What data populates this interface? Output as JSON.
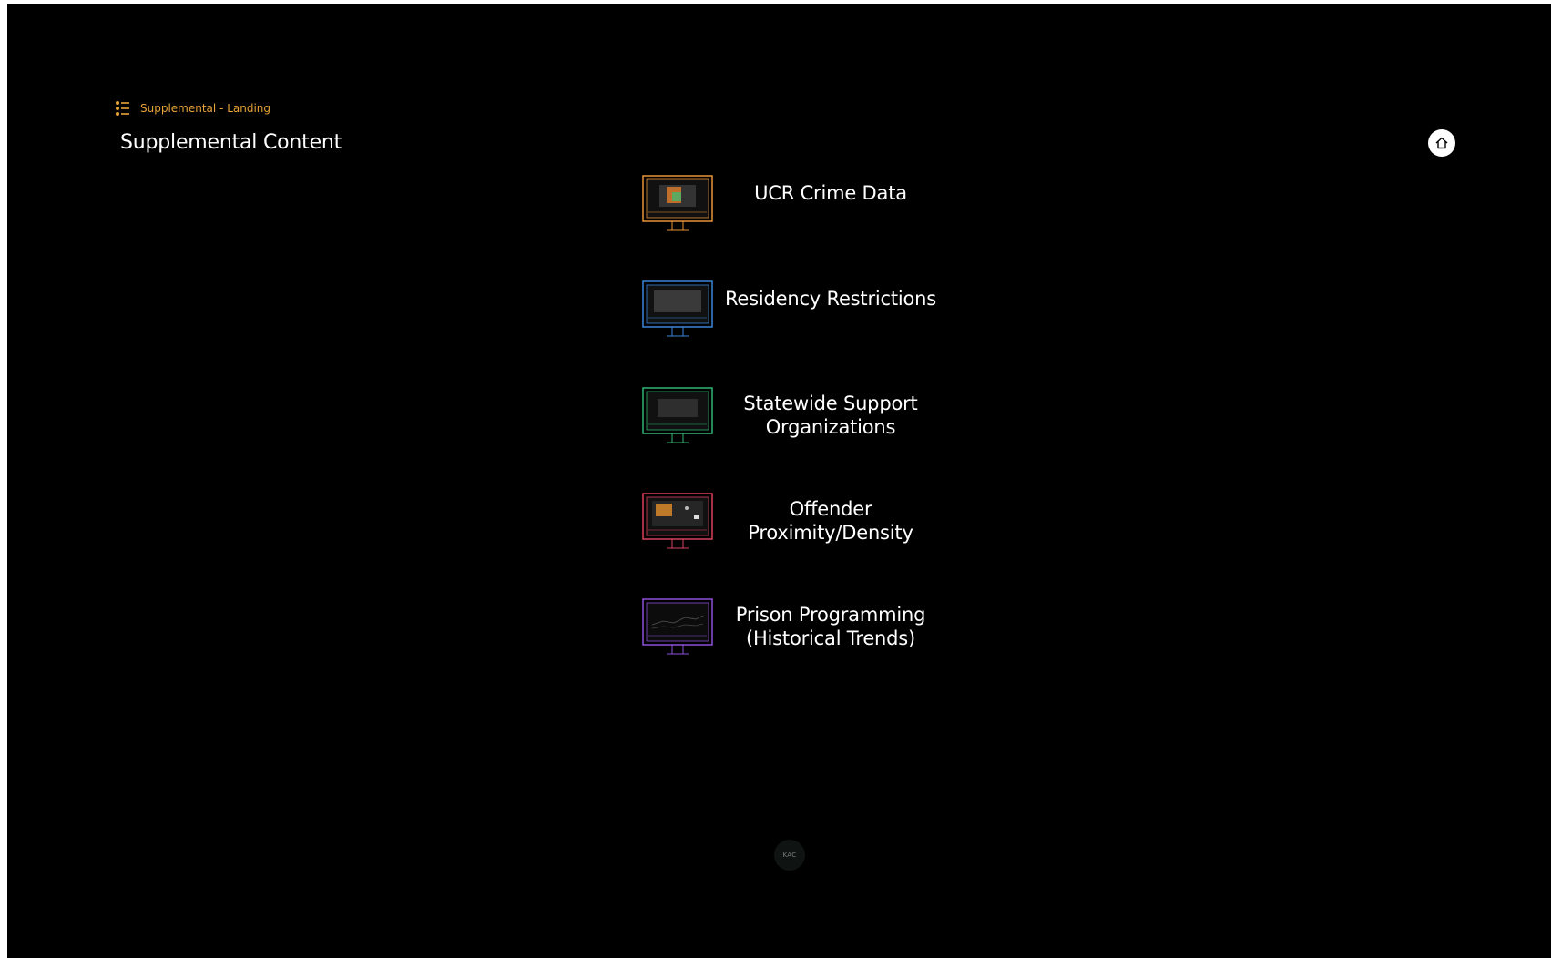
{
  "breadcrumb": {
    "label": "Supplemental - Landing",
    "icon": "list-icon",
    "color": "#e8a33a"
  },
  "page": {
    "title": "Supplemental Content"
  },
  "home_button": {
    "icon": "home-icon"
  },
  "menu": {
    "items": [
      {
        "line1": "UCR Crime Data",
        "line2": "",
        "color": "#e8933a",
        "icon": "monitor-icon"
      },
      {
        "line1": "Residency Restrictions",
        "line2": "",
        "color": "#3a86d9",
        "icon": "monitor-icon"
      },
      {
        "line1": "Statewide Support",
        "line2": "Organizations",
        "color": "#2fb574",
        "icon": "monitor-icon"
      },
      {
        "line1": "Offender",
        "line2": "Proximity/Density",
        "color": "#d9405e",
        "icon": "monitor-icon"
      },
      {
        "line1": "Prison Programming",
        "line2": "(Historical Trends)",
        "color": "#8c4fd9",
        "icon": "monitor-icon"
      }
    ]
  },
  "footer": {
    "logo_text": "KAC"
  }
}
